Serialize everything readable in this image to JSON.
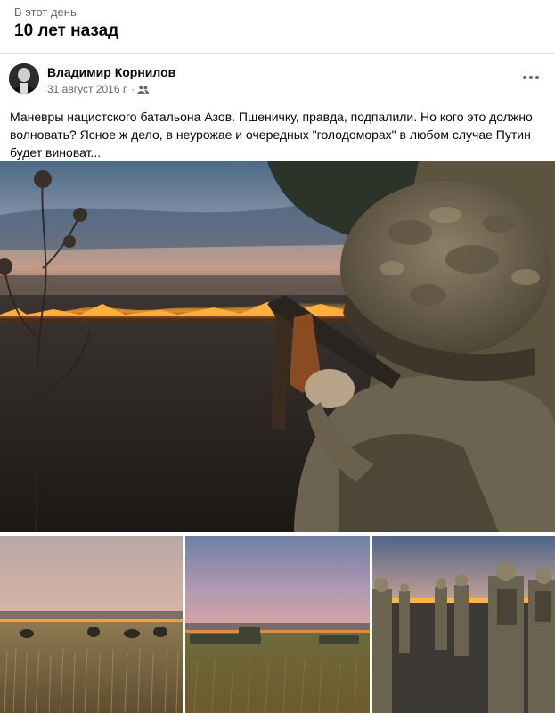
{
  "memory": {
    "label": "В этот день",
    "title": "10 лет назад"
  },
  "post": {
    "author": "Владимир Корнилов",
    "date": "31 август 2016 г.",
    "separator": "·",
    "privacy_icon": "friends-icon",
    "more_icon": "more-options-icon",
    "text": "Маневры нацистского батальона Азов. Пшеничку, правда, подпалили. Но кого это должно волновать? Ясное ж дело, в неурожае и очередных \"голодоморах\" в любом случае Путин будет виноват..."
  },
  "photos": [
    {
      "name": "soldier-rifle-burning-field-photo"
    },
    {
      "name": "soldiers-in-wheat-field-photo"
    },
    {
      "name": "armored-vehicles-field-photo"
    },
    {
      "name": "soldiers-walking-burnt-field-photo"
    }
  ],
  "colors": {
    "text": "#050505",
    "secondary": "#65676b",
    "divider": "#dcdfe3",
    "background": "#ffffff"
  }
}
